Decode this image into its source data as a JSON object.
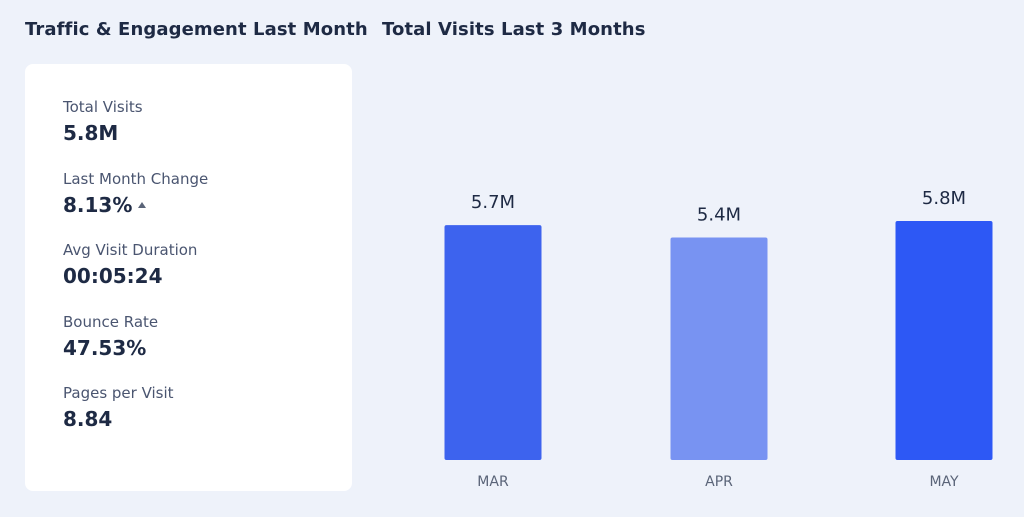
{
  "left_panel": {
    "title": "Traffic & Engagement Last Month",
    "stats": [
      {
        "label": "Total Visits",
        "value": "5.8M"
      },
      {
        "label": "Last Month Change",
        "value": "8.13%",
        "trend": "up"
      },
      {
        "label": "Avg Visit Duration",
        "value": "00:05:24"
      },
      {
        "label": "Bounce Rate",
        "value": "47.53%"
      },
      {
        "label": "Pages per Visit",
        "value": "8.84"
      }
    ]
  },
  "chart_data": {
    "type": "bar",
    "title": "Total Visits Last 3 Months",
    "categories": [
      "MAR",
      "APR",
      "MAY"
    ],
    "values": [
      5.7,
      5.4,
      5.8
    ],
    "value_labels": [
      "5.7M",
      "5.4M",
      "5.8M"
    ],
    "bar_colors": [
      "#3d63ee",
      "#7893f2",
      "#2d58f5"
    ],
    "ylim": [
      0,
      5.8
    ],
    "grid": false
  }
}
